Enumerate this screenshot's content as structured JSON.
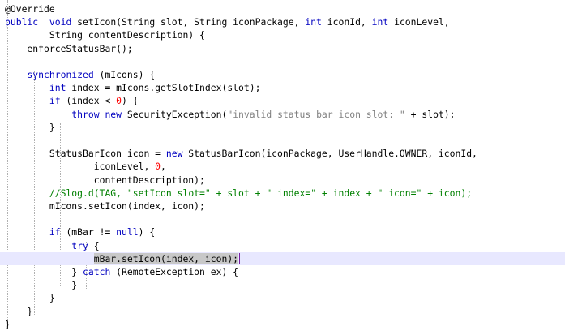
{
  "editor": {
    "lines": [
      [
        [
          "ann",
          "@Override"
        ]
      ],
      [
        [
          "kw",
          "public"
        ],
        [
          "",
          "  "
        ],
        [
          "kw",
          "void"
        ],
        [
          "",
          " setIcon(String slot, String iconPackage, "
        ],
        [
          "kw",
          "int"
        ],
        [
          "",
          " iconId, "
        ],
        [
          "kw",
          "int"
        ],
        [
          "",
          " iconLevel,"
        ]
      ],
      [
        [
          "",
          "        String contentDescription) {"
        ]
      ],
      [
        [
          "",
          "    enforceStatusBar();"
        ]
      ],
      [
        [
          "",
          ""
        ]
      ],
      [
        [
          "",
          "    "
        ],
        [
          "kw",
          "synchronized"
        ],
        [
          "",
          " (mIcons) {"
        ]
      ],
      [
        [
          "",
          "        "
        ],
        [
          "kw",
          "int"
        ],
        [
          "",
          " index = mIcons.getSlotIndex(slot);"
        ]
      ],
      [
        [
          "",
          "        "
        ],
        [
          "kw",
          "if"
        ],
        [
          "",
          " (index < "
        ],
        [
          "num",
          "0"
        ],
        [
          "",
          ") {"
        ]
      ],
      [
        [
          "",
          "            "
        ],
        [
          "kw",
          "throw"
        ],
        [
          "",
          " "
        ],
        [
          "kw",
          "new"
        ],
        [
          "",
          " SecurityException("
        ],
        [
          "str",
          "\"invalid status bar icon slot: \""
        ],
        [
          "",
          " + slot);"
        ]
      ],
      [
        [
          "",
          "        }"
        ]
      ],
      [
        [
          "",
          ""
        ]
      ],
      [
        [
          "",
          "        StatusBarIcon icon = "
        ],
        [
          "kw",
          "new"
        ],
        [
          "",
          " StatusBarIcon(iconPackage, UserHandle.OWNER, iconId,"
        ]
      ],
      [
        [
          "",
          "                iconLevel, "
        ],
        [
          "num",
          "0"
        ],
        [
          "",
          ","
        ]
      ],
      [
        [
          "",
          "                contentDescription);"
        ]
      ],
      [
        [
          "",
          "        "
        ],
        [
          "com",
          "//Slog.d(TAG, \"setIcon slot=\" + slot + \" index=\" + index + \" icon=\" + icon);"
        ]
      ],
      [
        [
          "",
          "        mIcons.setIcon(index, icon);"
        ]
      ],
      [
        [
          "",
          ""
        ]
      ],
      [
        [
          "",
          "        "
        ],
        [
          "kw",
          "if"
        ],
        [
          "",
          " (mBar != "
        ],
        [
          "kw",
          "null"
        ],
        [
          "",
          ") {"
        ]
      ],
      [
        [
          "",
          "            "
        ],
        [
          "kw",
          "try"
        ],
        [
          "",
          " {"
        ]
      ],
      [
        [
          "",
          "                "
        ],
        [
          "sel",
          "mBar.setIcon(index, icon);"
        ]
      ],
      [
        [
          "",
          "            } "
        ],
        [
          "kw",
          "catch"
        ],
        [
          "",
          " (RemoteException ex) {"
        ]
      ],
      [
        [
          "",
          "            }"
        ]
      ],
      [
        [
          "",
          "        }"
        ]
      ],
      [
        [
          "",
          "    }"
        ]
      ],
      [
        [
          "",
          "}"
        ]
      ]
    ]
  }
}
